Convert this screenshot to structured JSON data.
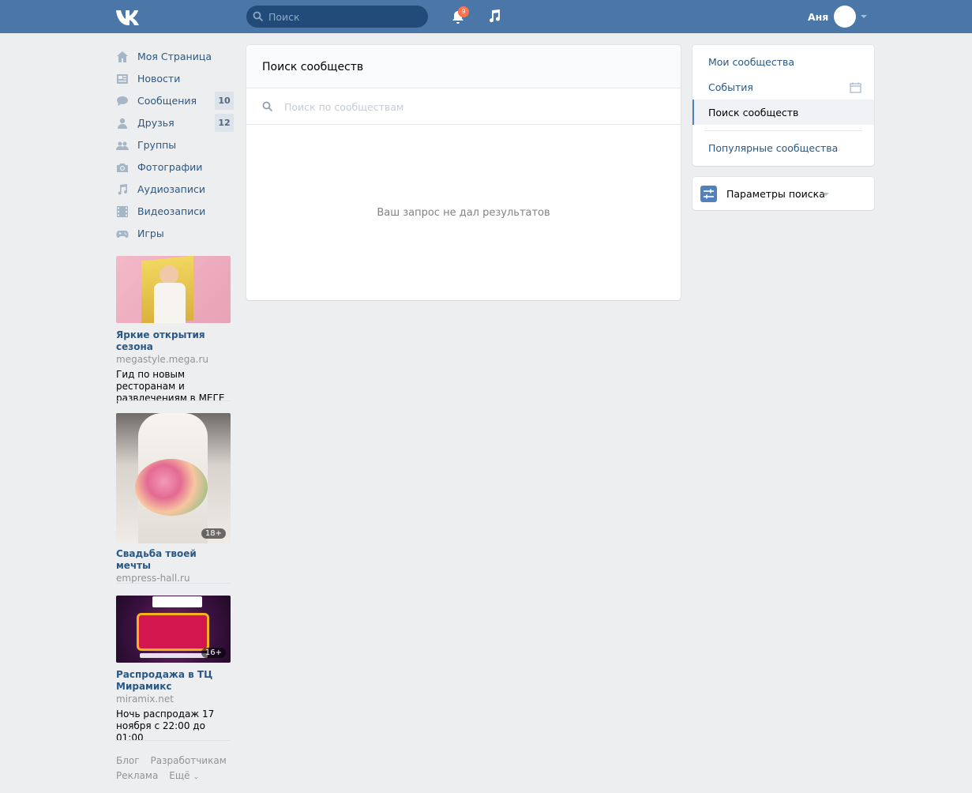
{
  "header": {
    "search_placeholder": "Поиск",
    "notifications_count": "9",
    "user_name": "Аня"
  },
  "nav": {
    "items": [
      {
        "label": "Моя Страница",
        "icon": "home-icon"
      },
      {
        "label": "Новости",
        "icon": "news-icon"
      },
      {
        "label": "Сообщения",
        "icon": "messages-icon",
        "count": "10"
      },
      {
        "label": "Друзья",
        "icon": "friends-icon",
        "count": "12"
      },
      {
        "label": "Группы",
        "icon": "groups-icon"
      },
      {
        "label": "Фотографии",
        "icon": "camera-icon"
      },
      {
        "label": "Аудиозаписи",
        "icon": "music-note-icon"
      },
      {
        "label": "Видеозаписи",
        "icon": "film-icon"
      },
      {
        "label": "Игры",
        "icon": "gamepad-icon"
      }
    ]
  },
  "ads": [
    {
      "title": "Яркие открытия сезона",
      "domain": "megastyle.mega.ru",
      "desc": "Гид по новым ресторанам и развлечениям в МЕГЕ",
      "age": ""
    },
    {
      "title": "Свадьба твоей мечты",
      "domain": "empress-hall.ru",
      "desc": "",
      "age": "18+"
    },
    {
      "title": "Распродажа в ТЦ Мирамикс",
      "domain": "miramix.net",
      "desc": "Ночь распродаж 17 ноября с 22:00 до 01:00",
      "age": "16+"
    }
  ],
  "footer": {
    "blog": "Блог",
    "developers": "Разработчикам",
    "ads": "Реклама",
    "more": "Ещё"
  },
  "main": {
    "title": "Поиск сообществ",
    "search_placeholder": "Поиск по сообществам",
    "empty_message": "Ваш запрос не дал результатов"
  },
  "right_menu": {
    "items": [
      {
        "label": "Мои сообщества"
      },
      {
        "label": "События"
      },
      {
        "label": "Поиск сообществ",
        "active": true
      },
      {
        "label": "Популярные сообщества"
      }
    ]
  },
  "search_params": {
    "label": "Параметры поиска"
  },
  "colors": {
    "header_bg": "#4a76a8",
    "link": "#2a5885",
    "page_bg": "#edeef0",
    "badge": "#ff734c"
  }
}
